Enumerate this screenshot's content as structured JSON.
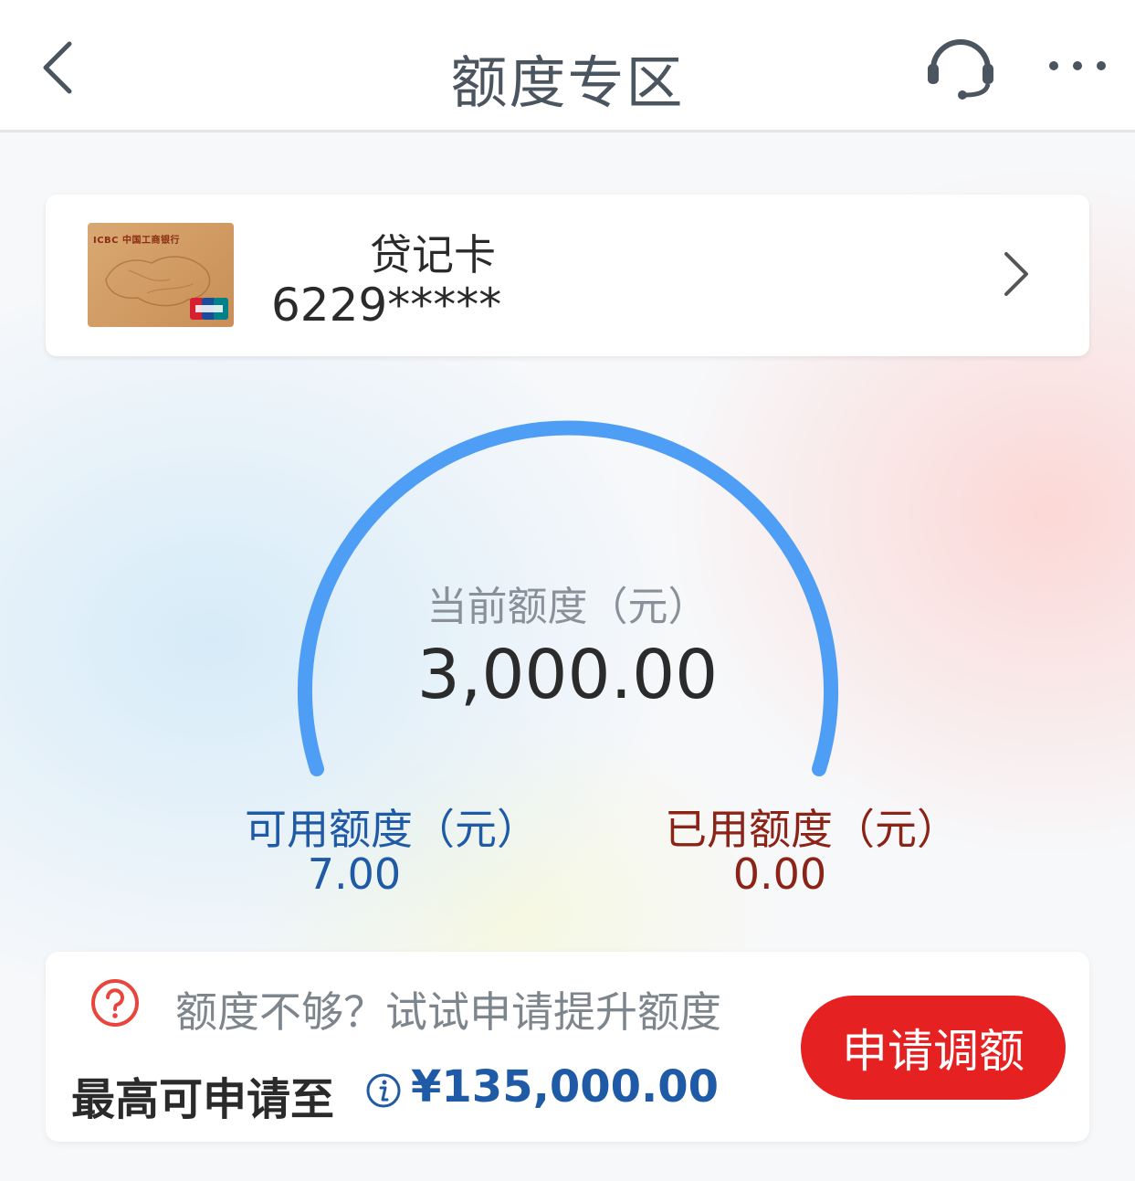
{
  "header": {
    "title": "额度专区",
    "back_icon": "chevron-left-icon",
    "service_icon": "headset-icon",
    "more_icon": "more-dots-icon"
  },
  "card": {
    "bank_name": "ICBC 中国工商银行",
    "type": "贷记卡",
    "number_masked": "6229*****",
    "network_icon": "unionpay-icon"
  },
  "gauge": {
    "current_limit_label": "当前额度（元）",
    "current_limit_value": "3,000.00",
    "available_label": "可用额度（元）",
    "available_value": "7.00",
    "used_label": "已用额度（元）",
    "used_value": "0.00",
    "arc_color": "#4e9ef5"
  },
  "promo": {
    "hint_text": "额度不够？试试申请提升额度",
    "max_label": "最高可申请至",
    "max_value": "¥135,000.00",
    "apply_button_label": "申请调额",
    "accent_color": "#e62121"
  }
}
